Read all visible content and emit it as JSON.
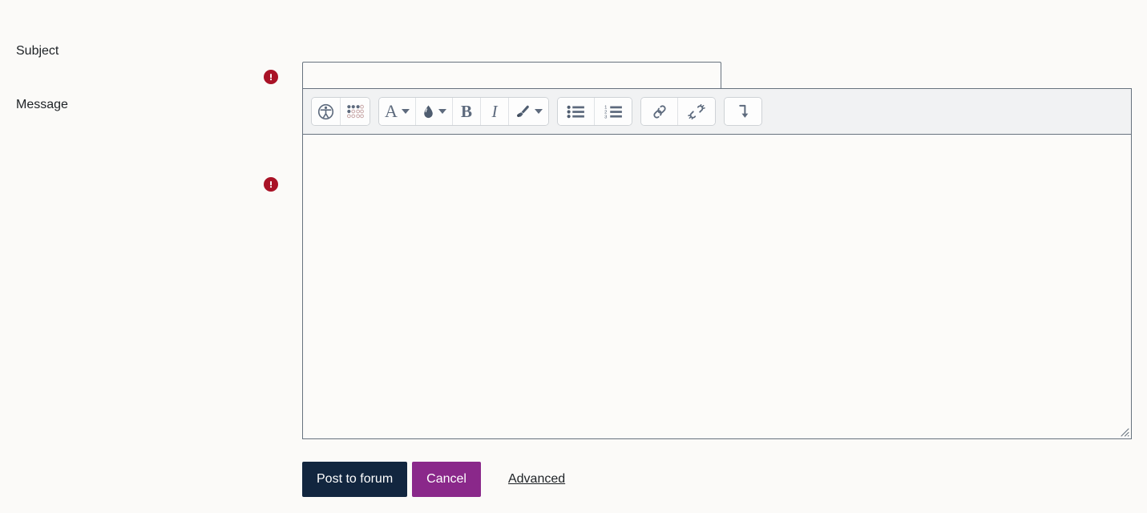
{
  "form": {
    "fields": [
      {
        "label": "Subject",
        "required_icon": "required-exclamation-icon",
        "input_value": "",
        "input_placeholder": ""
      },
      {
        "label": "Message",
        "required_icon": "required-exclamation-icon",
        "editor_value": "",
        "editor_placeholder": ""
      }
    ]
  },
  "editor": {
    "toolbar_groups": [
      {
        "name": "accessibility-group",
        "buttons": [
          {
            "icon": "accessibility-checker-icon",
            "has_caret": false
          },
          {
            "icon": "screenreader-helper-icon",
            "has_caret": false
          }
        ]
      },
      {
        "name": "text-style-group",
        "buttons": [
          {
            "icon": "font-style-icon",
            "glyph": "A",
            "has_caret": true
          },
          {
            "icon": "text-color-droplet-icon",
            "has_caret": true
          },
          {
            "icon": "bold-icon",
            "glyph": "B",
            "has_caret": false
          },
          {
            "icon": "italic-icon",
            "glyph": "I",
            "has_caret": false
          },
          {
            "icon": "paintbrush-icon",
            "has_caret": true
          }
        ]
      },
      {
        "name": "list-group",
        "buttons": [
          {
            "icon": "unordered-list-icon",
            "has_caret": false
          },
          {
            "icon": "ordered-list-icon",
            "has_caret": false
          }
        ]
      },
      {
        "name": "link-group",
        "buttons": [
          {
            "icon": "link-icon",
            "has_caret": false
          },
          {
            "icon": "unlink-icon",
            "has_caret": false
          }
        ]
      },
      {
        "name": "expand-group",
        "buttons": [
          {
            "icon": "show-more-buttons-arrow-icon",
            "has_caret": false
          }
        ]
      }
    ],
    "resize_handle_icon": "resize-grip-icon"
  },
  "actions": {
    "post_label": "Post to forum",
    "cancel_label": "Cancel",
    "advanced_label": "Advanced"
  },
  "colors": {
    "page_background": "#fbfaf8",
    "primary_button": "#12263f",
    "secondary_button": "#8a288a",
    "required_marker": "#a91226",
    "border": "#67727e",
    "toolbar_background": "#f1f2f3",
    "icon": "#5d6a7d",
    "text": "#1d2125"
  }
}
